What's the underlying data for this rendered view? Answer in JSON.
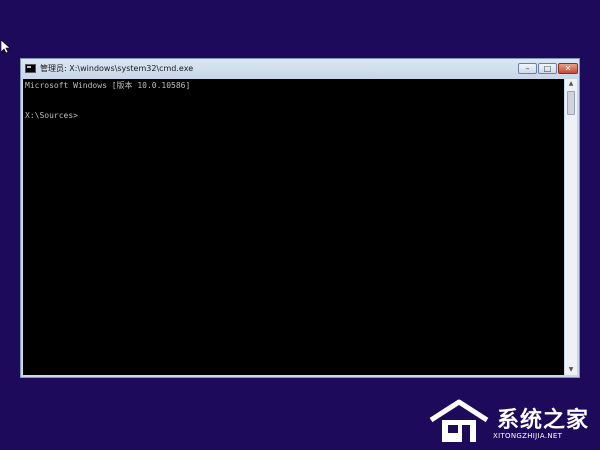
{
  "window": {
    "title": "管理员: X:\\windows\\system32\\cmd.exe",
    "buttons": {
      "minimize": "–",
      "maximize": "□",
      "close": "✕"
    }
  },
  "console": {
    "lines": [
      "Microsoft Windows [版本 10.0.10586]",
      "X:\\Sources>"
    ]
  },
  "scrollbar": {
    "up": "▲",
    "down": "▼"
  },
  "watermark": {
    "name": "系统之家",
    "url": "XITONGZHIJIA.NET"
  },
  "colors": {
    "desktop": "#1e0a5a",
    "console_bg": "#000000",
    "console_text": "#bfbfbf",
    "close_button": "#c74a35"
  }
}
